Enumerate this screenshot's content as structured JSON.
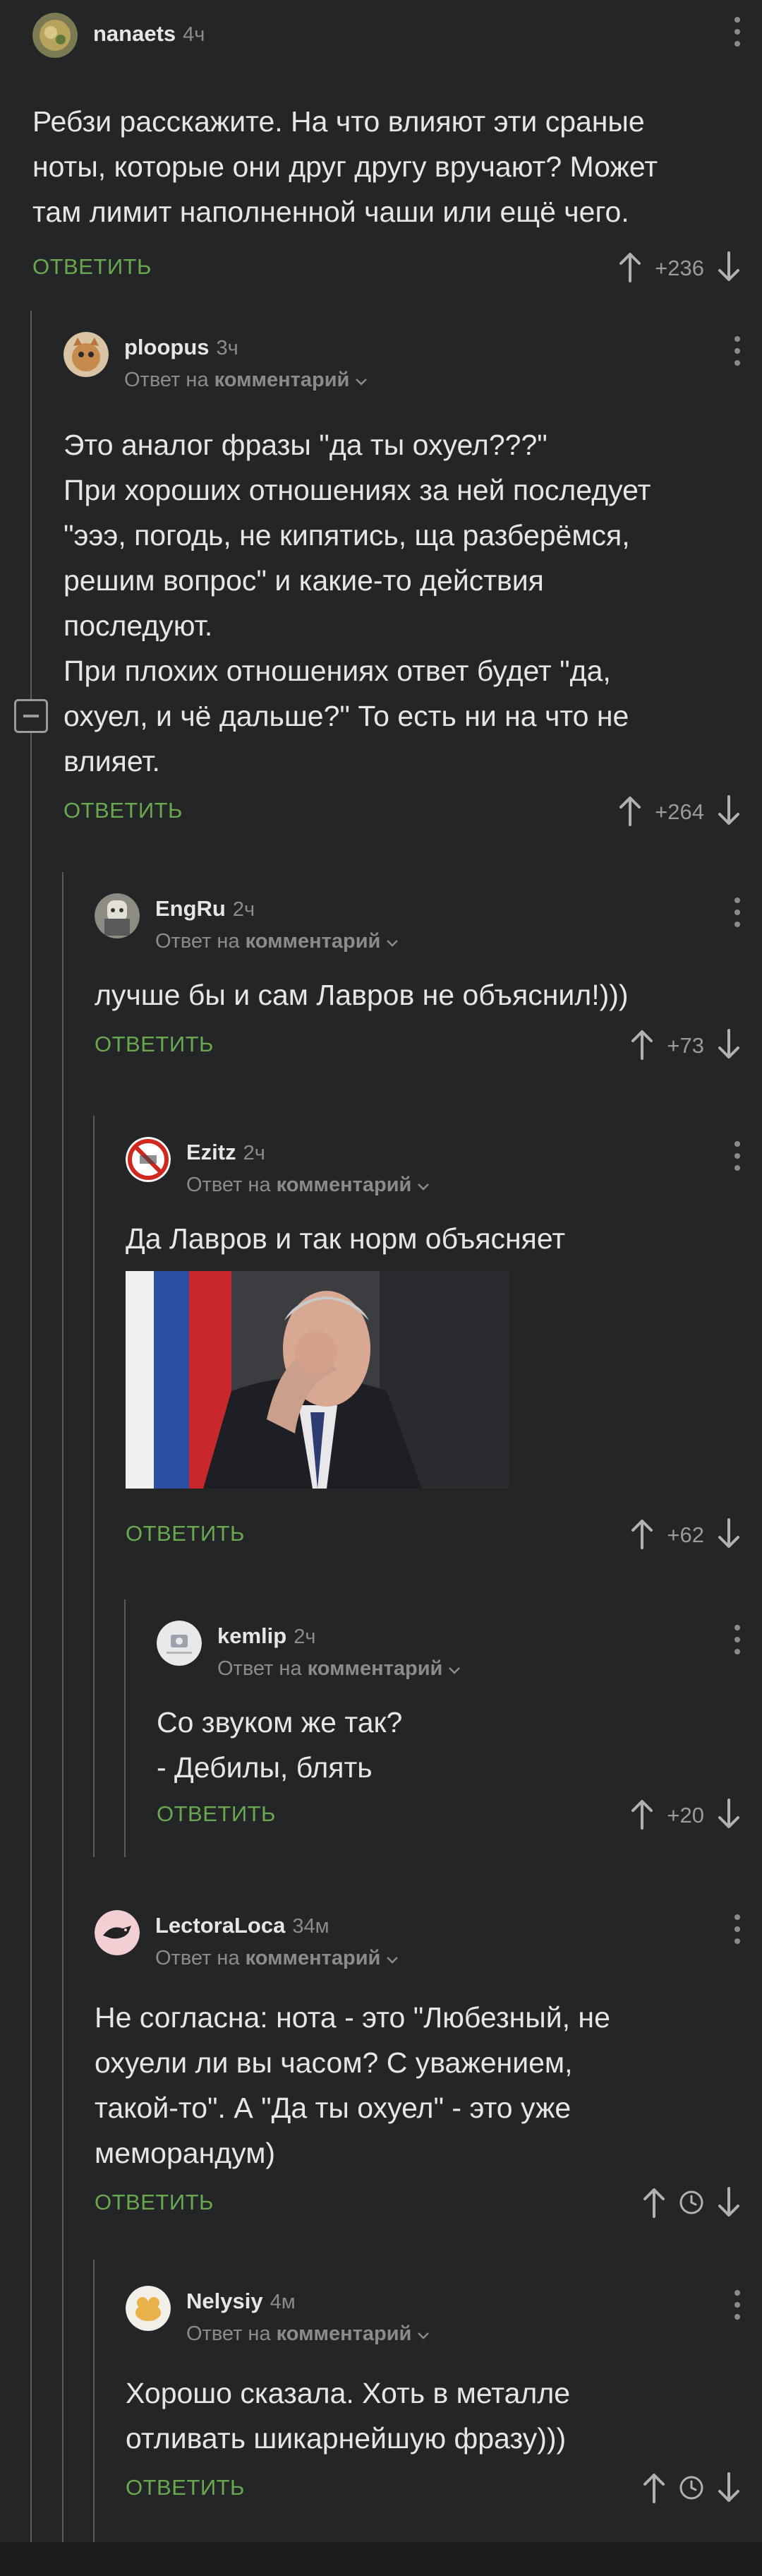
{
  "answer_label": "ОТВЕТИТЬ",
  "reply_prefix": "Ответ на",
  "reply_target": "комментарий",
  "colors": {
    "background": "#242527",
    "answer_green": "#6aa84f",
    "muted": "#8a8b8d",
    "thread_line": "#5a5b5d"
  },
  "comments": [
    {
      "user": "nanaets",
      "time": "4ч",
      "lines": [
        "Ребзи расскажите. На что влияют эти сраные",
        "ноты, которые они друг другу вручают? Может",
        "там лимит наполненной чаши или ещё чего."
      ],
      "rating": "+236"
    },
    {
      "user": "ploopus",
      "time": "3ч",
      "lines": [
        "Это аналог фразы \"да ты охуел???\"",
        "При хороших отношениях за ней последует",
        "\"эээ, погодь, не кипятись, ща разберёмся,",
        "решим вопрос\" и какие-то действия",
        "последуют.",
        "При плохих отношениях ответ будет \"да,",
        "охуел, и чё дальше?\" То есть ни на что не",
        "влияет."
      ],
      "rating": "+264"
    },
    {
      "user": "EngRu",
      "time": "2ч",
      "lines": [
        "лучше бы и сам Лавров не объяснил!)))"
      ],
      "rating": "+73"
    },
    {
      "user": "Ezitz",
      "time": "2ч",
      "lines": [
        "Да Лавров и так норм объясняет"
      ],
      "rating": "+62"
    },
    {
      "user": "kemlip",
      "time": "2ч",
      "lines": [
        "Со звуком же так?",
        "- Дебилы, блять"
      ],
      "rating": "+20"
    },
    {
      "user": "LectoraLoca",
      "time": "34м",
      "lines": [
        "Не согласна: нота - это \"Любезный, не",
        "охуели ли вы часом? С уважением,",
        "такой-то\". А \"Да ты охуел\" - это уже",
        "меморандум)"
      ],
      "rating": ""
    },
    {
      "user": "Nelysiy",
      "time": "4м",
      "lines": [
        "Хорошо сказала. Хоть в металле",
        "отливать шикарнейшую фразу)))"
      ],
      "rating": ""
    }
  ]
}
